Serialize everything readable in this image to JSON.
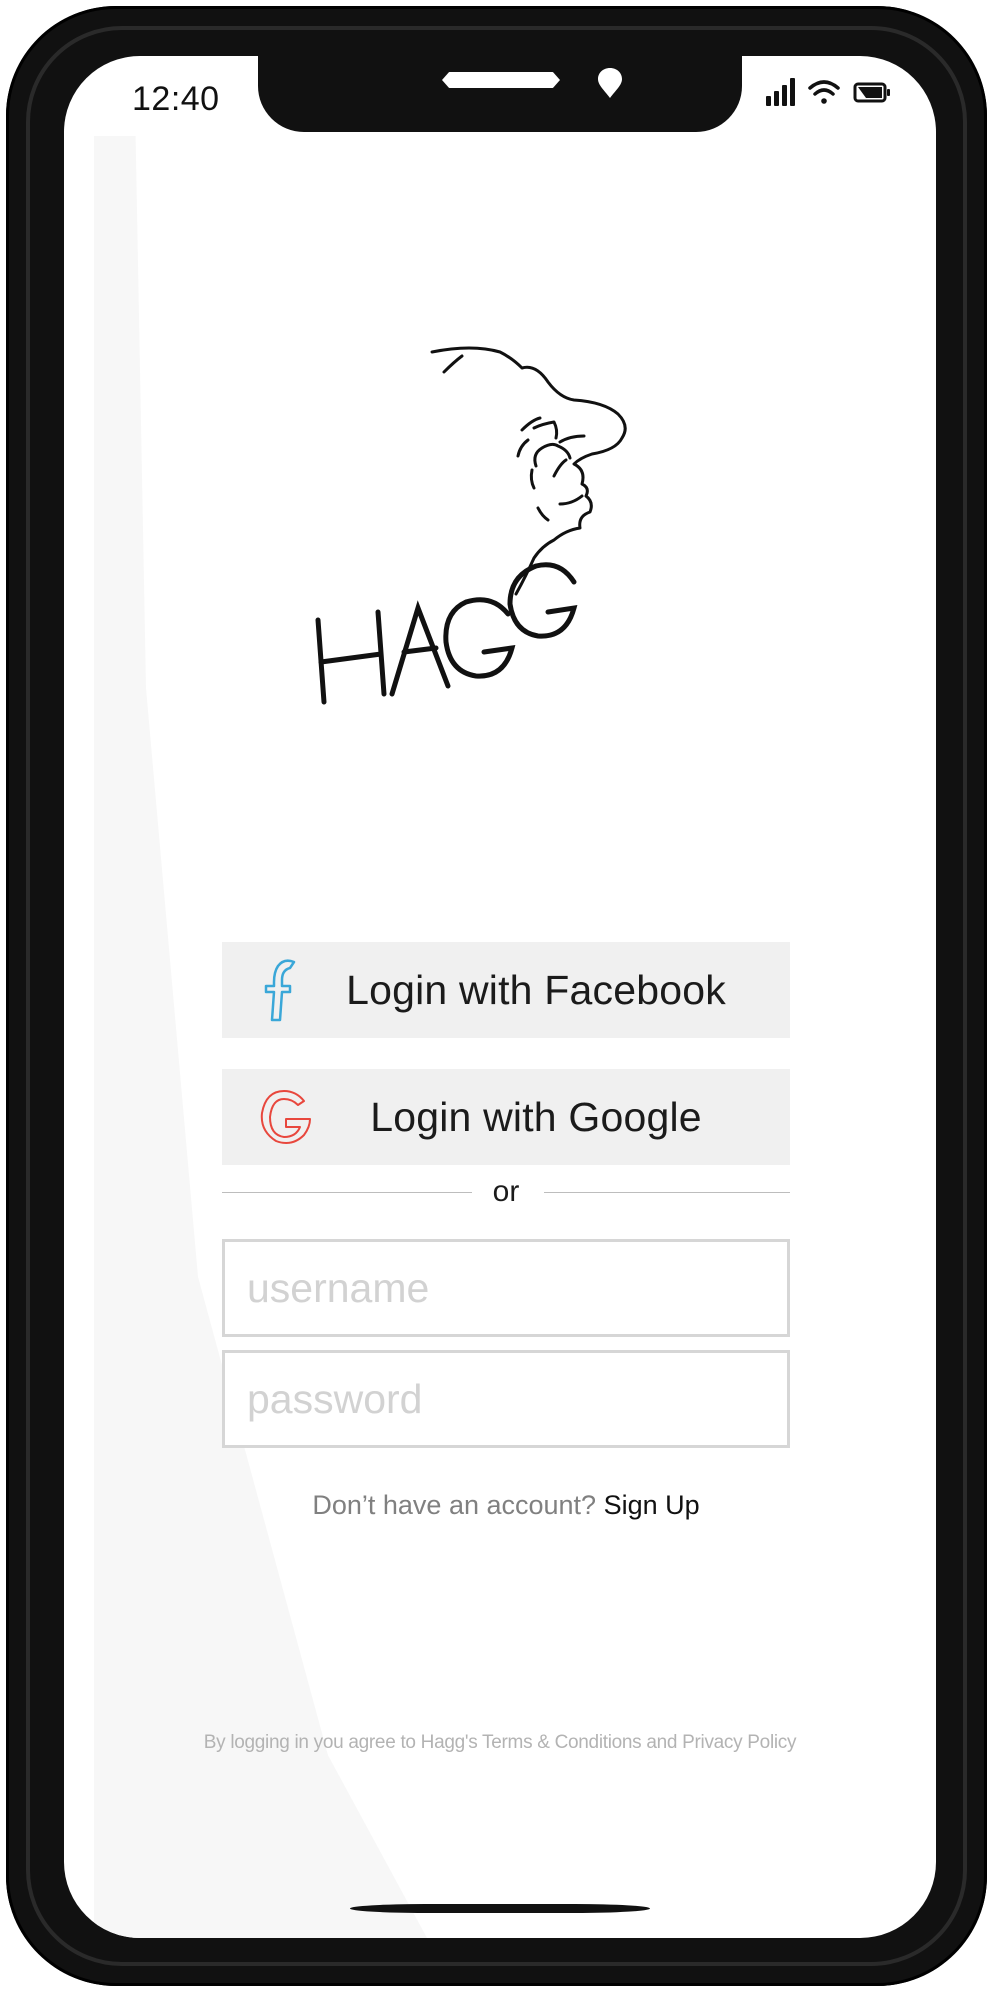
{
  "status_bar": {
    "time": "12:40",
    "icons": [
      "signal-icon",
      "wifi-icon",
      "battery-icon"
    ]
  },
  "logo": {
    "text": "HAGG",
    "icon": "face-line-art-logo"
  },
  "login_facebook": {
    "label": "Login with Facebook",
    "icon": "facebook-icon",
    "icon_color": "#3aa7d8"
  },
  "login_google": {
    "label": "Login with Google",
    "icon": "google-icon",
    "icon_color": "#e8473d"
  },
  "divider": {
    "text": "or"
  },
  "form": {
    "username_placeholder": "username",
    "password_placeholder": "password"
  },
  "signup": {
    "prompt": "Don’t have an account?",
    "link": "Sign Up"
  },
  "legal": {
    "text": "By logging in you agree to Hagg's Terms & Conditions and Privacy Policy"
  },
  "colors": {
    "button_bg": "#f0f0f0",
    "field_border": "#d6d6d6",
    "frame": "#111111"
  }
}
